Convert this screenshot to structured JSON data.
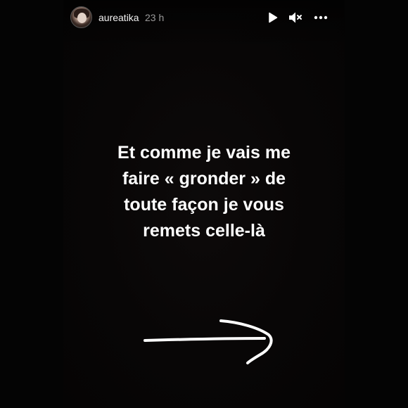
{
  "story": {
    "username": "aureatika",
    "timestamp": "23 h",
    "text_lines": [
      "Et comme je vais me",
      "faire « gronder » de",
      "toute façon je vous",
      "remets celle-là"
    ]
  },
  "controls": {
    "play_icon": "play-icon",
    "mute_icon": "speaker-muted-icon",
    "more_icon": "more-horizontal-icon"
  },
  "colors": {
    "background": "#020202",
    "story_background": "#080606",
    "text": "#ffffff",
    "timestamp": "#9a9a9a"
  }
}
